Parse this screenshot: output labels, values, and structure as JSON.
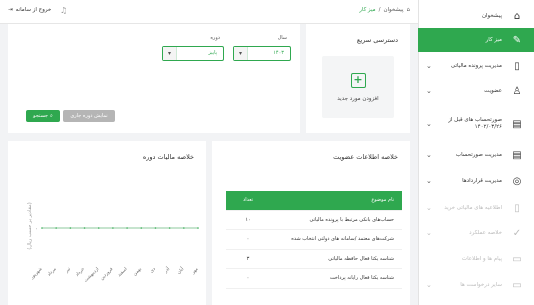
{
  "topbar": {
    "breadcrumb_home": "پیشخوان",
    "breadcrumb_sep": "/",
    "breadcrumb_current": "میز کار",
    "logout_label": "خروج از سامانه"
  },
  "sidebar": {
    "items": [
      {
        "label": "پیشخوان",
        "icon": "home-icon",
        "glyph": "⌂"
      },
      {
        "label": "میز کار",
        "icon": "desk-icon",
        "glyph": "✎"
      },
      {
        "label": "مدیریت پرونده مالیاتی",
        "icon": "file-icon",
        "glyph": "▯"
      },
      {
        "label": "عضویت",
        "icon": "user-icon",
        "glyph": "♙"
      },
      {
        "label": "صورتحساب های قبل از ۱۴۰۲/۰۳/۲۶",
        "icon": "invoice-icon",
        "glyph": "▤"
      },
      {
        "label": "مدیریت صورتحساب",
        "icon": "invoice-manage-icon",
        "glyph": "▤"
      },
      {
        "label": "مدیریت قراردادها",
        "icon": "contract-icon",
        "glyph": "◎"
      },
      {
        "label": "اطلاعیه های مالیاتی خرید",
        "icon": "notice-icon",
        "glyph": "▯"
      },
      {
        "label": "خلاصه عملکرد",
        "icon": "summary-icon",
        "glyph": "✓"
      },
      {
        "label": "پیام ها و اطلاعات",
        "icon": "message-icon",
        "glyph": "▭"
      },
      {
        "label": "سایر درخواست ها",
        "icon": "request-icon",
        "glyph": "▭"
      }
    ]
  },
  "quick_access": {
    "title": "دسترسی سریع",
    "tile_label": "افزودن مورد جدید"
  },
  "filter": {
    "year_label": "سال",
    "year_value": "۱۴۰۳",
    "period_label": "دوره",
    "period_value": "پاییز",
    "search_label": "جستجو",
    "current_label": "نمایش دوره جاری"
  },
  "membership": {
    "title": "خلاصه اطلاعات عضویت",
    "col_topic": "نام موضوع",
    "col_count": "تعداد",
    "rows": [
      {
        "name": "حساب‌های بانکی مرتبط با پرونده مالیاتی",
        "count": "۱۰"
      },
      {
        "name": "شرکت‌های معتمد /سامانه های دولتی انتخاب شده",
        "count": "۰"
      },
      {
        "name": "شناسه یکتا فعال حافظه مالیاتی",
        "count": "۳"
      },
      {
        "name": "شناسه یکتا فعال رایانه پرداخت",
        "count": "۰"
      }
    ]
  },
  "tax": {
    "title": "خلاصه مالیات دوره",
    "ylabel": "(مقادیر بر حسب ریال)"
  },
  "chart_data": {
    "type": "line",
    "title": "خلاصه مالیات دوره",
    "ylabel": "(مقادیر بر حسب ریال)",
    "y_ticks": [
      "۰"
    ],
    "categories": [
      "شهریور",
      "مرداد",
      "تیر",
      "خرداد",
      "اردیبهشت",
      "فروردین",
      "اسفند",
      "بهمن",
      "دی",
      "آذر",
      "آبان",
      "مهر"
    ],
    "values": [
      0,
      0,
      0,
      0,
      0,
      0,
      0,
      0,
      0,
      0,
      0,
      0
    ]
  },
  "colors": {
    "accent": "#2fa84f",
    "muted": "#b5b5b5"
  }
}
